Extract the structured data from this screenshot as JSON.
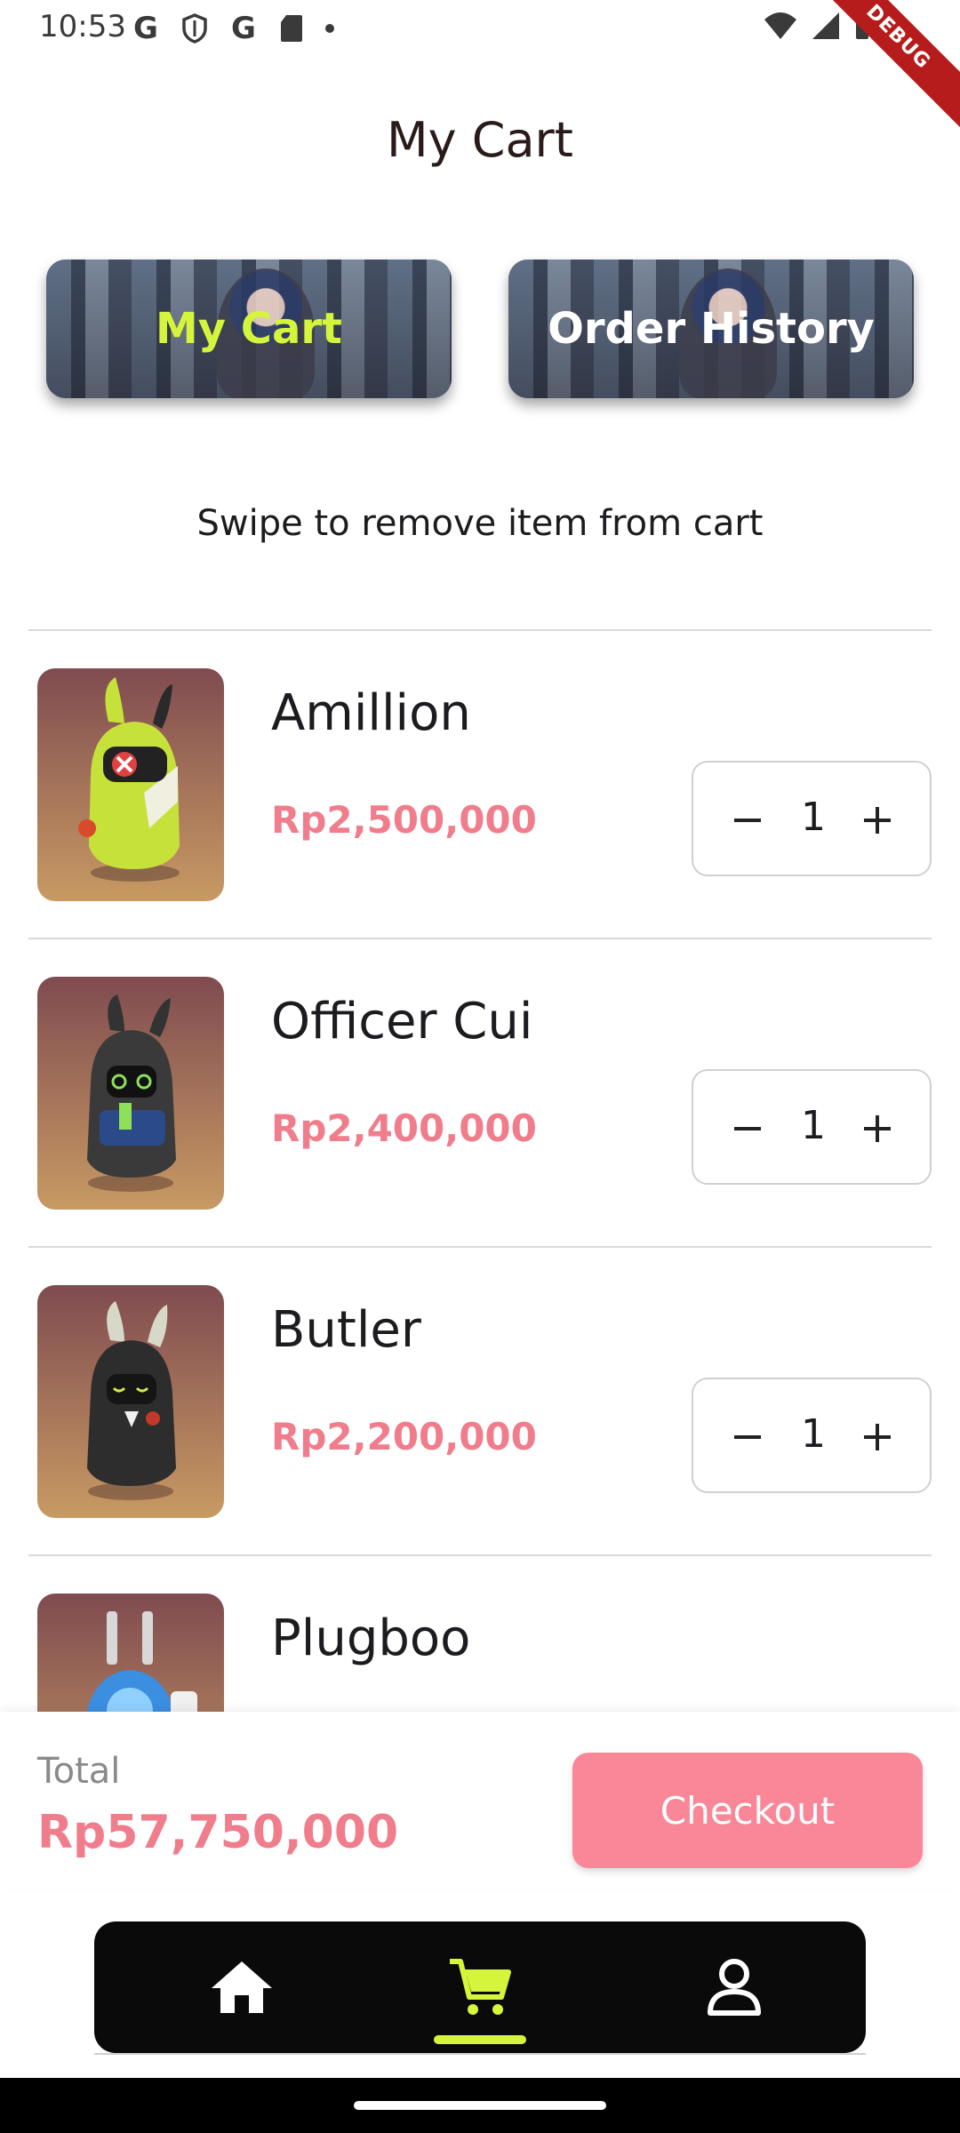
{
  "status_bar": {
    "time": "10:53",
    "left_icons": [
      "google-g-icon",
      "shield-icon",
      "google-g-icon",
      "sd-card-icon",
      "dot-icon"
    ],
    "right_icons": [
      "wifi-icon",
      "signal-icon",
      "battery-icon"
    ]
  },
  "debug_banner": "DEBUG",
  "header": {
    "title": "My Cart"
  },
  "tabs": [
    {
      "label": "My Cart",
      "active": true,
      "color": "#d4f53c"
    },
    {
      "label": "Order History",
      "active": false,
      "color": "#ffffff"
    }
  ],
  "hint": "Swipe to remove item from cart",
  "cart": {
    "items": [
      {
        "name": "Amillion",
        "price": "Rp2,500,000",
        "quantity": "1"
      },
      {
        "name": "Officer Cui",
        "price": "Rp2,400,000",
        "quantity": "1"
      },
      {
        "name": "Butler",
        "price": "Rp2,200,000",
        "quantity": "1"
      },
      {
        "name": "Plugboo",
        "price": "",
        "quantity": ""
      }
    ]
  },
  "summary": {
    "total_label": "Total",
    "total_value": "Rp57,750,000",
    "checkout_label": "Checkout"
  },
  "bottom_nav": {
    "items": [
      {
        "icon": "home-icon",
        "active": false
      },
      {
        "icon": "cart-icon",
        "active": true
      },
      {
        "icon": "profile-icon",
        "active": false
      }
    ],
    "active_color": "#d4f53c"
  },
  "colors": {
    "accent_pink": "#f07d8c",
    "checkout_bg": "#f98797",
    "active_green": "#d4f53c"
  }
}
